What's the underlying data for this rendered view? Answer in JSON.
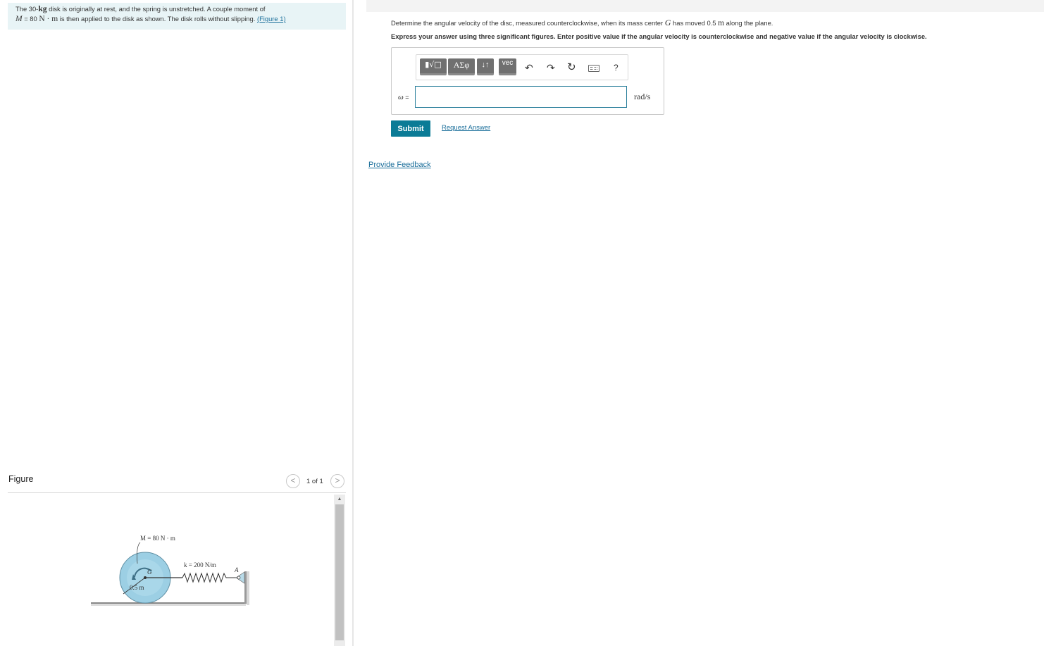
{
  "problem": {
    "text_1": "The 30-",
    "mass_unit": "kg",
    "text_2": " disk is originally at rest, and the spring is unstretched. A couple moment of",
    "moment_symbol": "M",
    "moment_eq": " = 80 ",
    "moment_unit": "N · m",
    "text_3": " is then applied to the disk as shown. The disk rolls without slipping. ",
    "figure_link": "(Figure 1)"
  },
  "figure": {
    "title": "Figure",
    "prev_icon": "<",
    "next_icon": ">",
    "page_count": "1 of 1",
    "moment_label": "M = 80 N · m",
    "spring_label": "k = 200 N/m",
    "center_label": "G",
    "radius_label": "0.5 m",
    "anchor_label": "A"
  },
  "scrollbar": {
    "up_arrow": "▲"
  },
  "question": {
    "text_1": "Determine the angular velocity of the disc, measured counterclockwise, when its mass center ",
    "symbol": "G",
    "text_2": " has moved 0.5 ",
    "unit": "m",
    "text_3": " along the plane.",
    "instruction": "Express your answer using three significant figures. Enter positive value if the angular velocity is counterclockwise and negative value if the angular velocity is clockwise."
  },
  "toolbar": {
    "templates": "▮√□",
    "greek": "ΑΣφ",
    "arrows": "↓↑",
    "vec": "vec",
    "undo": "↶",
    "redo": "↷",
    "reset": "↻",
    "help": "?"
  },
  "answer": {
    "label_symbol": "ω",
    "label_eq": " =",
    "value": "",
    "unit": "rad/s"
  },
  "actions": {
    "submit": "Submit",
    "request_answer": "Request Answer",
    "provide_feedback": "Provide Feedback"
  },
  "colors": {
    "problem_bg": "#e8f4f6",
    "accent": "#0b7b96",
    "link": "#1a6e9a",
    "disk_fill": "#9ccfe4"
  }
}
